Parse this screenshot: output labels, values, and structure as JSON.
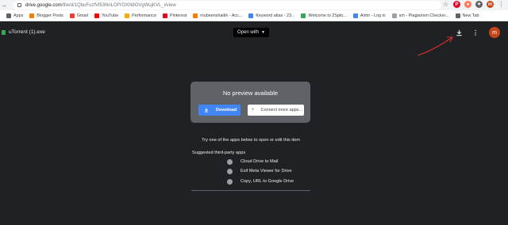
{
  "browser": {
    "url_host": "drive.google.com",
    "url_path": "/file/d/1QbuFuzfVl53NnLOfYOXN8OVgWujKVL_i/view",
    "extensions": [
      {
        "name": "pinterest-extension-icon",
        "color": "#e60023",
        "glyph": "P"
      },
      {
        "name": "hubspot-extension-icon",
        "color": "#ff7a59",
        "glyph": "●"
      },
      {
        "name": "puzzle-extension-icon",
        "color": "#5f6368",
        "glyph": "✦"
      },
      {
        "name": "profile-avatar",
        "color": "#c5461b",
        "glyph": "m"
      }
    ]
  },
  "bookmarks": [
    {
      "label": "Apps",
      "icon": "apps-grid-icon",
      "color": "#5f6368"
    },
    {
      "label": "Blogger Posts",
      "icon": "blogger-icon",
      "color": "#f57d00"
    },
    {
      "label": "Gmail",
      "icon": "gmail-icon",
      "color": "#ea4335"
    },
    {
      "label": "YouTube",
      "icon": "youtube-icon",
      "color": "#ff0000"
    },
    {
      "label": "Performance",
      "icon": "performance-icon",
      "color": "#f9ab00"
    },
    {
      "label": "Pinterest",
      "icon": "pinterest-icon",
      "color": "#e60023"
    },
    {
      "label": "mubeenshaikh - Acc...",
      "icon": "blogger-icon",
      "color": "#f57d00"
    },
    {
      "label": "Keyword atlas - 23...",
      "icon": "keyword-icon",
      "color": "#4285f4"
    },
    {
      "label": "Welcome to 2Spto...",
      "icon": "welcome-icon",
      "color": "#34a853"
    },
    {
      "label": "Aimn - Log in",
      "icon": "cloud-icon",
      "color": "#4285f4"
    },
    {
      "label": "sm - Plagiarism Checker...",
      "icon": "plagiarism-icon",
      "color": "#9aa0a6"
    },
    {
      "label": "New Tab",
      "icon": "new-tab-icon",
      "color": "#5f6368"
    }
  ],
  "viewer": {
    "file_title": "uTorrent (1).exe",
    "open_with_label": "Open with",
    "avatar_letter": "m"
  },
  "preview": {
    "title": "No preview available",
    "download_label": "Download",
    "connect_label": "Connect more apps..."
  },
  "apps_section": {
    "try_text": "Try one of the apps below to open or edit this item",
    "suggested_label": "Suggested third-party apps",
    "apps": [
      {
        "label": "Cloud Drive to Mail"
      },
      {
        "label": "Exif Meta Viewer for Drive"
      },
      {
        "label": "Copy, URL to Google Drive"
      }
    ]
  }
}
